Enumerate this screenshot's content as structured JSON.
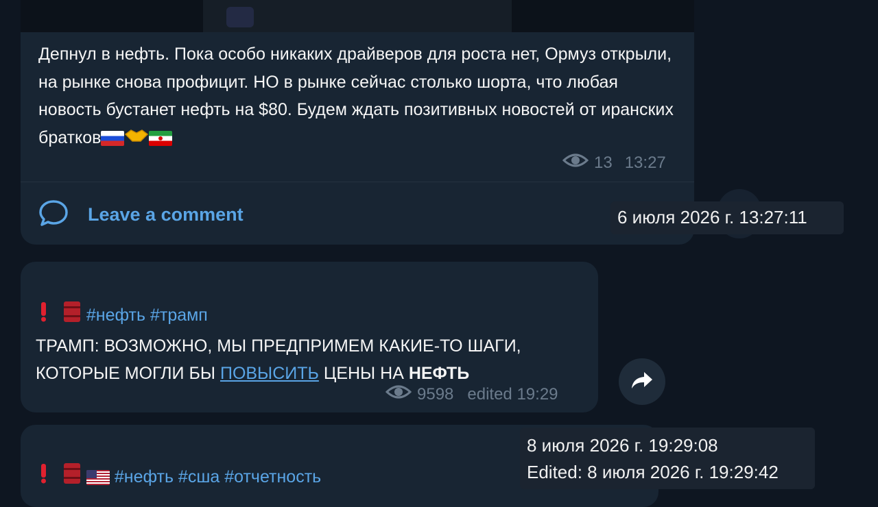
{
  "post1": {
    "text": "Депнул в нефть. Пока особо никаких драйверов для роста нет, Ормуз открыли, на рынке снова профицит. НО в рынке сейчас столько шорта, что любая новость бустанет нефть на $80. Будем ждать позитивных новостей от иранских братков",
    "views": "13",
    "time": "13:27",
    "comment_label": "Leave a comment"
  },
  "tooltip1": {
    "text": "6 июля 2026 г. 13:27:11"
  },
  "post2": {
    "hashtags": "#нефть #трамп",
    "line1": "ТРАМП: ВОЗМОЖНО, МЫ ПРЕДПРИМЕМ КАКИЕ-ТО ШАГИ,",
    "line2_pre": "КОТОРЫЕ МОГЛИ БЫ ",
    "line2_link": "ПОВЫСИТЬ",
    "line2_mid": " ЦЕНЫ НА ",
    "line2_bold": "НЕФТЬ",
    "views": "9598",
    "edited": "edited 19:29"
  },
  "tooltip2": {
    "line1": "8 июля 2026 г. 19:29:08",
    "line2": "Edited: 8 июля 2026 г. 19:29:42"
  },
  "post3": {
    "hashtags": "#нефть #сша #отчетность"
  },
  "colors": {
    "bg": "#0e1621",
    "bubble": "#182533",
    "accent": "#5aa5e6",
    "meta": "#6b7b8c"
  },
  "icons": [
    "eye-icon",
    "comment-icon",
    "share-icon",
    "exclamation-icon",
    "oil-barrel-icon",
    "handshake-icon",
    "flag-russia-icon",
    "flag-iran-icon",
    "flag-usa-icon"
  ]
}
